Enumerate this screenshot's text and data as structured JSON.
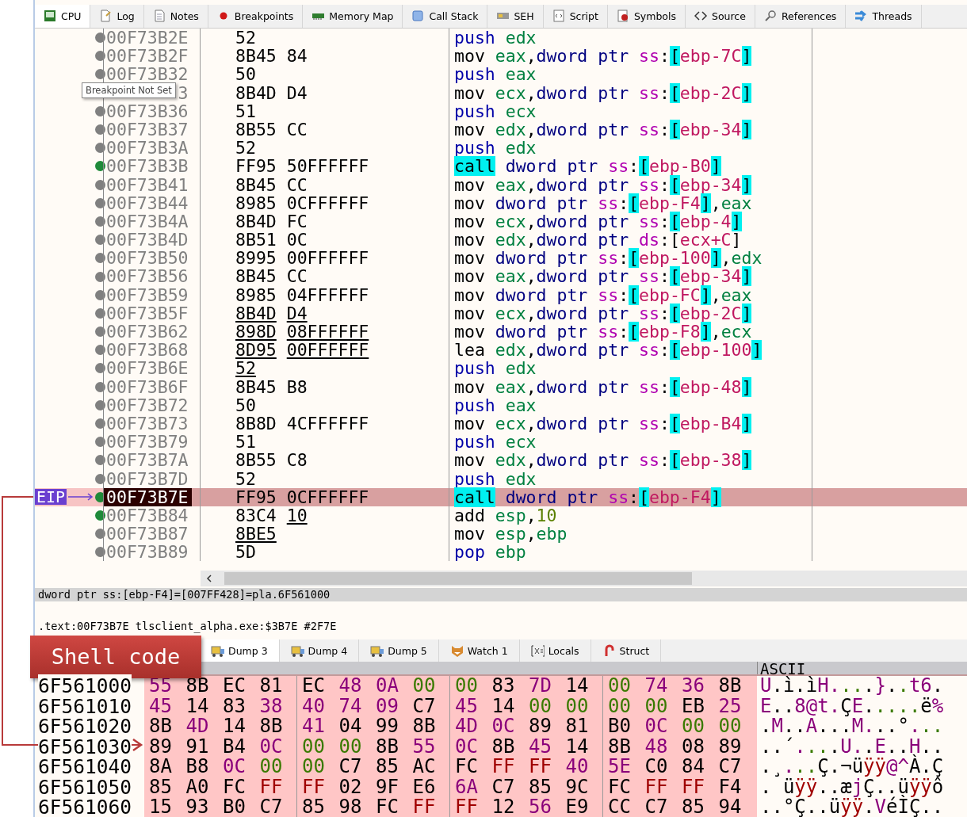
{
  "tabs": [
    {
      "label": "CPU",
      "selected": true
    },
    {
      "label": "Log",
      "selected": false
    },
    {
      "label": "Notes",
      "selected": false
    },
    {
      "label": "Breakpoints",
      "selected": false
    },
    {
      "label": "Memory Map",
      "selected": false
    },
    {
      "label": "Call Stack",
      "selected": false
    },
    {
      "label": "SEH",
      "selected": false
    },
    {
      "label": "Script",
      "selected": false
    },
    {
      "label": "Symbols",
      "selected": false
    },
    {
      "label": "Source",
      "selected": false
    },
    {
      "label": "References",
      "selected": false
    },
    {
      "label": "Threads",
      "selected": false
    }
  ],
  "eip_label": "EIP",
  "tooltip": {
    "text": "Breakpoint Not Set"
  },
  "disassembly": [
    {
      "address": "00F73B2E",
      "breakpoint": false,
      "selected": false,
      "eip": false,
      "bytes": [
        {
          "text": "52",
          "underlined": false
        }
      ],
      "mnemonic": {
        "text": "push",
        "kind": "stack"
      },
      "operands": [
        {
          "text": "edx",
          "kind": "reg"
        }
      ]
    },
    {
      "address": "00F73B2F",
      "breakpoint": false,
      "selected": false,
      "eip": false,
      "bytes": [
        {
          "text": "8B45 84",
          "underlined": false
        }
      ],
      "mnemonic": {
        "text": "mov",
        "kind": "move"
      },
      "operands": [
        {
          "text": "eax",
          "kind": "reg"
        },
        {
          "text": ",",
          "kind": "punct"
        },
        {
          "text": "dword ptr ",
          "kind": "size"
        },
        {
          "text": "ss",
          "kind": "seg"
        },
        {
          "text": ":",
          "kind": "punct"
        },
        {
          "text": "[",
          "kind": "bracket"
        },
        {
          "text": "ebp-7C",
          "kind": "mem"
        },
        {
          "text": "]",
          "kind": "bracket"
        }
      ]
    },
    {
      "address": "00F73B32",
      "breakpoint": false,
      "selected": false,
      "eip": false,
      "bytes": [
        {
          "text": "50",
          "underlined": false
        }
      ],
      "mnemonic": {
        "text": "push",
        "kind": "stack"
      },
      "operands": [
        {
          "text": "eax",
          "kind": "reg"
        }
      ]
    },
    {
      "address": "3",
      "selected": false,
      "eip": false,
      "bytes": [
        {
          "text": "8B4D D4",
          "underlined": false
        }
      ],
      "mnemonic": {
        "text": "mov",
        "kind": "move"
      },
      "operands": [
        {
          "text": "ecx",
          "kind": "reg"
        },
        {
          "text": ",",
          "kind": "punct"
        },
        {
          "text": "dword ptr ",
          "kind": "size"
        },
        {
          "text": "ss",
          "kind": "seg"
        },
        {
          "text": ":",
          "kind": "punct"
        },
        {
          "text": "[",
          "kind": "bracket"
        },
        {
          "text": "ebp-2C",
          "kind": "mem"
        },
        {
          "text": "]",
          "kind": "bracket"
        }
      ]
    },
    {
      "address": "00F73B36",
      "breakpoint": false,
      "selected": false,
      "eip": false,
      "bytes": [
        {
          "text": "51",
          "underlined": false
        }
      ],
      "mnemonic": {
        "text": "push",
        "kind": "stack"
      },
      "operands": [
        {
          "text": "ecx",
          "kind": "reg"
        }
      ]
    },
    {
      "address": "00F73B37",
      "breakpoint": false,
      "selected": false,
      "eip": false,
      "bytes": [
        {
          "text": "8B55 CC",
          "underlined": false
        }
      ],
      "mnemonic": {
        "text": "mov",
        "kind": "move"
      },
      "operands": [
        {
          "text": "edx",
          "kind": "reg"
        },
        {
          "text": ",",
          "kind": "punct"
        },
        {
          "text": "dword ptr ",
          "kind": "size"
        },
        {
          "text": "ss",
          "kind": "seg"
        },
        {
          "text": ":",
          "kind": "punct"
        },
        {
          "text": "[",
          "kind": "bracket"
        },
        {
          "text": "ebp-34",
          "kind": "mem"
        },
        {
          "text": "]",
          "kind": "bracket"
        }
      ]
    },
    {
      "address": "00F73B3A",
      "breakpoint": false,
      "selected": false,
      "eip": false,
      "bytes": [
        {
          "text": "52",
          "underlined": false
        }
      ],
      "mnemonic": {
        "text": "push",
        "kind": "stack"
      },
      "operands": [
        {
          "text": "edx",
          "kind": "reg"
        }
      ]
    },
    {
      "address": "00F73B3B",
      "breakpoint": true,
      "selected": false,
      "eip": false,
      "bytes": [
        {
          "text": "FF95 50FFFFFF",
          "underlined": false
        }
      ],
      "mnemonic": {
        "text": "call",
        "kind": "call"
      },
      "operands": [
        {
          "text": "dword ptr ",
          "kind": "size"
        },
        {
          "text": "ss",
          "kind": "seg"
        },
        {
          "text": ":",
          "kind": "punct"
        },
        {
          "text": "[",
          "kind": "bracket"
        },
        {
          "text": "ebp-B0",
          "kind": "mem"
        },
        {
          "text": "]",
          "kind": "bracket"
        }
      ]
    },
    {
      "address": "00F73B41",
      "breakpoint": false,
      "selected": false,
      "eip": false,
      "bytes": [
        {
          "text": "8B45 CC",
          "underlined": false
        }
      ],
      "mnemonic": {
        "text": "mov",
        "kind": "move"
      },
      "operands": [
        {
          "text": "eax",
          "kind": "reg"
        },
        {
          "text": ",",
          "kind": "punct"
        },
        {
          "text": "dword ptr ",
          "kind": "size"
        },
        {
          "text": "ss",
          "kind": "seg"
        },
        {
          "text": ":",
          "kind": "punct"
        },
        {
          "text": "[",
          "kind": "bracket"
        },
        {
          "text": "ebp-34",
          "kind": "mem"
        },
        {
          "text": "]",
          "kind": "bracket"
        }
      ]
    },
    {
      "address": "00F73B44",
      "breakpoint": false,
      "selected": false,
      "eip": false,
      "bytes": [
        {
          "text": "8985 0CFFFFFF",
          "underlined": false
        }
      ],
      "mnemonic": {
        "text": "mov",
        "kind": "move"
      },
      "operands": [
        {
          "text": "dword ptr ",
          "kind": "size"
        },
        {
          "text": "ss",
          "kind": "seg"
        },
        {
          "text": ":",
          "kind": "punct"
        },
        {
          "text": "[",
          "kind": "bracket"
        },
        {
          "text": "ebp-F4",
          "kind": "mem"
        },
        {
          "text": "]",
          "kind": "bracket"
        },
        {
          "text": ",",
          "kind": "punct"
        },
        {
          "text": "eax",
          "kind": "reg"
        }
      ]
    },
    {
      "address": "00F73B4A",
      "breakpoint": false,
      "selected": false,
      "eip": false,
      "bytes": [
        {
          "text": "8B4D FC",
          "underlined": false
        }
      ],
      "mnemonic": {
        "text": "mov",
        "kind": "move"
      },
      "operands": [
        {
          "text": "ecx",
          "kind": "reg"
        },
        {
          "text": ",",
          "kind": "punct"
        },
        {
          "text": "dword ptr ",
          "kind": "size"
        },
        {
          "text": "ss",
          "kind": "seg"
        },
        {
          "text": ":",
          "kind": "punct"
        },
        {
          "text": "[",
          "kind": "bracket"
        },
        {
          "text": "ebp-4",
          "kind": "mem"
        },
        {
          "text": "]",
          "kind": "bracket"
        }
      ]
    },
    {
      "address": "00F73B4D",
      "breakpoint": false,
      "selected": false,
      "eip": false,
      "bytes": [
        {
          "text": "8B51 0C",
          "underlined": false
        }
      ],
      "mnemonic": {
        "text": "mov",
        "kind": "move"
      },
      "operands": [
        {
          "text": "edx",
          "kind": "reg"
        },
        {
          "text": ",",
          "kind": "punct"
        },
        {
          "text": "dword ptr ",
          "kind": "size"
        },
        {
          "text": "ds",
          "kind": "seg"
        },
        {
          "text": ":",
          "kind": "punct"
        },
        {
          "text": "[",
          "kind": "punct"
        },
        {
          "text": "ecx+C",
          "kind": "mem"
        },
        {
          "text": "]",
          "kind": "punct"
        }
      ]
    },
    {
      "address": "00F73B50",
      "breakpoint": false,
      "selected": false,
      "eip": false,
      "bytes": [
        {
          "text": "8995 00FFFFFF",
          "underlined": false
        }
      ],
      "mnemonic": {
        "text": "mov",
        "kind": "move"
      },
      "operands": [
        {
          "text": "dword ptr ",
          "kind": "size"
        },
        {
          "text": "ss",
          "kind": "seg"
        },
        {
          "text": ":",
          "kind": "punct"
        },
        {
          "text": "[",
          "kind": "bracket"
        },
        {
          "text": "ebp-100",
          "kind": "mem"
        },
        {
          "text": "]",
          "kind": "bracket"
        },
        {
          "text": ",",
          "kind": "punct"
        },
        {
          "text": "edx",
          "kind": "reg"
        }
      ]
    },
    {
      "address": "00F73B56",
      "breakpoint": false,
      "selected": false,
      "eip": false,
      "bytes": [
        {
          "text": "8B45 CC",
          "underlined": false
        }
      ],
      "mnemonic": {
        "text": "mov",
        "kind": "move"
      },
      "operands": [
        {
          "text": "eax",
          "kind": "reg"
        },
        {
          "text": ",",
          "kind": "punct"
        },
        {
          "text": "dword ptr ",
          "kind": "size"
        },
        {
          "text": "ss",
          "kind": "seg"
        },
        {
          "text": ":",
          "kind": "punct"
        },
        {
          "text": "[",
          "kind": "bracket"
        },
        {
          "text": "ebp-34",
          "kind": "mem"
        },
        {
          "text": "]",
          "kind": "bracket"
        }
      ]
    },
    {
      "address": "00F73B59",
      "breakpoint": false,
      "selected": false,
      "eip": false,
      "bytes": [
        {
          "text": "8985 04FFFFFF",
          "underlined": false
        }
      ],
      "mnemonic": {
        "text": "mov",
        "kind": "move"
      },
      "operands": [
        {
          "text": "dword ptr ",
          "kind": "size"
        },
        {
          "text": "ss",
          "kind": "seg"
        },
        {
          "text": ":",
          "kind": "punct"
        },
        {
          "text": "[",
          "kind": "bracket"
        },
        {
          "text": "ebp-FC",
          "kind": "mem"
        },
        {
          "text": "]",
          "kind": "bracket"
        },
        {
          "text": ",",
          "kind": "punct"
        },
        {
          "text": "eax",
          "kind": "reg"
        }
      ]
    },
    {
      "address": "00F73B5F",
      "breakpoint": false,
      "selected": false,
      "eip": false,
      "bytes": [
        {
          "text": "8B4D",
          "underlined": true
        },
        {
          "text": "D4",
          "underlined": true
        }
      ],
      "mnemonic": {
        "text": "mov",
        "kind": "move"
      },
      "operands": [
        {
          "text": "ecx",
          "kind": "reg"
        },
        {
          "text": ",",
          "kind": "punct"
        },
        {
          "text": "dword ptr ",
          "kind": "size"
        },
        {
          "text": "ss",
          "kind": "seg"
        },
        {
          "text": ":",
          "kind": "punct"
        },
        {
          "text": "[",
          "kind": "bracket"
        },
        {
          "text": "ebp-2C",
          "kind": "mem"
        },
        {
          "text": "]",
          "kind": "bracket"
        }
      ]
    },
    {
      "address": "00F73B62",
      "breakpoint": false,
      "selected": false,
      "eip": false,
      "bytes": [
        {
          "text": "898D",
          "underlined": true
        },
        {
          "text": "08FFFFFF",
          "underlined": true
        }
      ],
      "mnemonic": {
        "text": "mov",
        "kind": "move"
      },
      "operands": [
        {
          "text": "dword ptr ",
          "kind": "size"
        },
        {
          "text": "ss",
          "kind": "seg"
        },
        {
          "text": ":",
          "kind": "punct"
        },
        {
          "text": "[",
          "kind": "bracket"
        },
        {
          "text": "ebp-F8",
          "kind": "mem"
        },
        {
          "text": "]",
          "kind": "bracket"
        },
        {
          "text": ",",
          "kind": "punct"
        },
        {
          "text": "ecx",
          "kind": "reg"
        }
      ]
    },
    {
      "address": "00F73B68",
      "breakpoint": false,
      "selected": false,
      "eip": false,
      "bytes": [
        {
          "text": "8D95",
          "underlined": true
        },
        {
          "text": "00FFFFFF",
          "underlined": true
        }
      ],
      "mnemonic": {
        "text": "lea",
        "kind": "move"
      },
      "operands": [
        {
          "text": "edx",
          "kind": "reg"
        },
        {
          "text": ",",
          "kind": "punct"
        },
        {
          "text": "dword ptr ",
          "kind": "size"
        },
        {
          "text": "ss",
          "kind": "seg"
        },
        {
          "text": ":",
          "kind": "punct"
        },
        {
          "text": "[",
          "kind": "bracket"
        },
        {
          "text": "ebp-100",
          "kind": "mem"
        },
        {
          "text": "]",
          "kind": "bracket"
        }
      ]
    },
    {
      "address": "00F73B6E",
      "breakpoint": false,
      "selected": false,
      "eip": false,
      "bytes": [
        {
          "text": "52",
          "underlined": true
        }
      ],
      "mnemonic": {
        "text": "push",
        "kind": "stack"
      },
      "operands": [
        {
          "text": "edx",
          "kind": "reg"
        }
      ]
    },
    {
      "address": "00F73B6F",
      "breakpoint": false,
      "selected": false,
      "eip": false,
      "bytes": [
        {
          "text": "8B45 B8",
          "underlined": false
        }
      ],
      "mnemonic": {
        "text": "mov",
        "kind": "move"
      },
      "operands": [
        {
          "text": "eax",
          "kind": "reg"
        },
        {
          "text": ",",
          "kind": "punct"
        },
        {
          "text": "dword ptr ",
          "kind": "size"
        },
        {
          "text": "ss",
          "kind": "seg"
        },
        {
          "text": ":",
          "kind": "punct"
        },
        {
          "text": "[",
          "kind": "bracket"
        },
        {
          "text": "ebp-48",
          "kind": "mem"
        },
        {
          "text": "]",
          "kind": "bracket"
        }
      ]
    },
    {
      "address": "00F73B72",
      "breakpoint": false,
      "selected": false,
      "eip": false,
      "bytes": [
        {
          "text": "50",
          "underlined": false
        }
      ],
      "mnemonic": {
        "text": "push",
        "kind": "stack"
      },
      "operands": [
        {
          "text": "eax",
          "kind": "reg"
        }
      ]
    },
    {
      "address": "00F73B73",
      "breakpoint": false,
      "selected": false,
      "eip": false,
      "bytes": [
        {
          "text": "8B8D 4CFFFFFF",
          "underlined": false
        }
      ],
      "mnemonic": {
        "text": "mov",
        "kind": "move"
      },
      "operands": [
        {
          "text": "ecx",
          "kind": "reg"
        },
        {
          "text": ",",
          "kind": "punct"
        },
        {
          "text": "dword ptr ",
          "kind": "size"
        },
        {
          "text": "ss",
          "kind": "seg"
        },
        {
          "text": ":",
          "kind": "punct"
        },
        {
          "text": "[",
          "kind": "bracket"
        },
        {
          "text": "ebp-B4",
          "kind": "mem"
        },
        {
          "text": "]",
          "kind": "bracket"
        }
      ]
    },
    {
      "address": "00F73B79",
      "breakpoint": false,
      "selected": false,
      "eip": false,
      "bytes": [
        {
          "text": "51",
          "underlined": false
        }
      ],
      "mnemonic": {
        "text": "push",
        "kind": "stack"
      },
      "operands": [
        {
          "text": "ecx",
          "kind": "reg"
        }
      ]
    },
    {
      "address": "00F73B7A",
      "breakpoint": false,
      "selected": false,
      "eip": false,
      "bytes": [
        {
          "text": "8B55 C8",
          "underlined": false
        }
      ],
      "mnemonic": {
        "text": "mov",
        "kind": "move"
      },
      "operands": [
        {
          "text": "edx",
          "kind": "reg"
        },
        {
          "text": ",",
          "kind": "punct"
        },
        {
          "text": "dword ptr ",
          "kind": "size"
        },
        {
          "text": "ss",
          "kind": "seg"
        },
        {
          "text": ":",
          "kind": "punct"
        },
        {
          "text": "[",
          "kind": "bracket"
        },
        {
          "text": "ebp-38",
          "kind": "mem"
        },
        {
          "text": "]",
          "kind": "bracket"
        }
      ]
    },
    {
      "address": "00F73B7D",
      "breakpoint": false,
      "selected": false,
      "eip": false,
      "bytes": [
        {
          "text": "52",
          "underlined": false
        }
      ],
      "mnemonic": {
        "text": "push",
        "kind": "stack"
      },
      "operands": [
        {
          "text": "edx",
          "kind": "reg"
        }
      ]
    },
    {
      "address": "00F73B7E",
      "breakpoint": true,
      "selected": true,
      "eip": true,
      "bytes": [
        {
          "text": "FF95 0CFFFFFF",
          "underlined": false
        }
      ],
      "mnemonic": {
        "text": "call",
        "kind": "call"
      },
      "operands": [
        {
          "text": "dword ptr ",
          "kind": "size"
        },
        {
          "text": "ss",
          "kind": "seg"
        },
        {
          "text": ":",
          "kind": "punct"
        },
        {
          "text": "[",
          "kind": "bracket"
        },
        {
          "text": "ebp-F4",
          "kind": "mem"
        },
        {
          "text": "]",
          "kind": "bracket"
        }
      ]
    },
    {
      "address": "00F73B84",
      "breakpoint": true,
      "selected": false,
      "eip": false,
      "bytes": [
        {
          "text": "83C4",
          "underlined": false
        },
        {
          "text": "10",
          "underlined": true
        }
      ],
      "mnemonic": {
        "text": "add",
        "kind": "move"
      },
      "operands": [
        {
          "text": "esp",
          "kind": "reg"
        },
        {
          "text": ",",
          "kind": "punct"
        },
        {
          "text": "10",
          "kind": "num"
        }
      ]
    },
    {
      "address": "00F73B87",
      "breakpoint": false,
      "selected": false,
      "eip": false,
      "bytes": [
        {
          "text": "8BE5",
          "underlined": true
        }
      ],
      "mnemonic": {
        "text": "mov",
        "kind": "move"
      },
      "operands": [
        {
          "text": "esp",
          "kind": "reg"
        },
        {
          "text": ",",
          "kind": "punct"
        },
        {
          "text": "ebp",
          "kind": "reg"
        }
      ]
    },
    {
      "address": "00F73B89",
      "breakpoint": false,
      "selected": false,
      "eip": false,
      "bytes": [
        {
          "text": "5D",
          "underlined": false
        }
      ],
      "mnemonic": {
        "text": "pop",
        "kind": "stack"
      },
      "operands": [
        {
          "text": "ebp",
          "kind": "reg"
        }
      ]
    }
  ],
  "info": {
    "line_1": "dword ptr ss:[ebp-F4]=[007FF428]=pla.6F561000",
    "line_2": ".text:00F73B7E tlsclient_alpha.exe:$3B7E #2F7E"
  },
  "callout": {
    "text": "Shell code"
  },
  "bottom_tabs": [
    {
      "label": "Dump 3",
      "selected": true
    },
    {
      "label": "Dump 4",
      "selected": false
    },
    {
      "label": "Dump 5",
      "selected": false
    },
    {
      "label": "Watch 1",
      "selected": false
    },
    {
      "label": "Locals",
      "selected": false
    },
    {
      "label": "Struct",
      "selected": false
    }
  ],
  "dump": {
    "ascii_header": "ASCII",
    "rows": [
      {
        "address": "6F561000",
        "ascii": "U.ì.ìH....}..t6.",
        "bytes": [
          {
            "text": "55",
            "kind": "print"
          },
          {
            "text": "8B",
            "kind": "other"
          },
          {
            "text": "EC",
            "kind": "other"
          },
          {
            "text": "81",
            "kind": "other"
          },
          {
            "text": "EC",
            "kind": "other"
          },
          {
            "text": "48",
            "kind": "print"
          },
          {
            "text": "0A",
            "kind": "print"
          },
          {
            "text": "00",
            "kind": "zero"
          },
          {
            "text": "00",
            "kind": "zero"
          },
          {
            "text": "83",
            "kind": "other"
          },
          {
            "text": "7D",
            "kind": "print"
          },
          {
            "text": "14",
            "kind": "other"
          },
          {
            "text": "00",
            "kind": "zero"
          },
          {
            "text": "74",
            "kind": "print"
          },
          {
            "text": "36",
            "kind": "print"
          },
          {
            "text": "8B",
            "kind": "other"
          }
        ]
      },
      {
        "address": "6F561010",
        "ascii": "E..8@t.ÇE.....ë%",
        "bytes": [
          {
            "text": "45",
            "kind": "print"
          },
          {
            "text": "14",
            "kind": "other"
          },
          {
            "text": "83",
            "kind": "other"
          },
          {
            "text": "38",
            "kind": "print"
          },
          {
            "text": "40",
            "kind": "print"
          },
          {
            "text": "74",
            "kind": "print"
          },
          {
            "text": "09",
            "kind": "print"
          },
          {
            "text": "C7",
            "kind": "other"
          },
          {
            "text": "45",
            "kind": "print"
          },
          {
            "text": "14",
            "kind": "other"
          },
          {
            "text": "00",
            "kind": "zero"
          },
          {
            "text": "00",
            "kind": "zero"
          },
          {
            "text": "00",
            "kind": "zero"
          },
          {
            "text": "00",
            "kind": "zero"
          },
          {
            "text": "EB",
            "kind": "other"
          },
          {
            "text": "25",
            "kind": "print"
          }
        ]
      },
      {
        "address": "6F561020",
        "ascii": ".M..A...M...°...",
        "bytes": [
          {
            "text": "8B",
            "kind": "other"
          },
          {
            "text": "4D",
            "kind": "print"
          },
          {
            "text": "14",
            "kind": "other"
          },
          {
            "text": "8B",
            "kind": "other"
          },
          {
            "text": "41",
            "kind": "print"
          },
          {
            "text": "04",
            "kind": "other"
          },
          {
            "text": "99",
            "kind": "other"
          },
          {
            "text": "8B",
            "kind": "other"
          },
          {
            "text": "4D",
            "kind": "print"
          },
          {
            "text": "0C",
            "kind": "print"
          },
          {
            "text": "89",
            "kind": "other"
          },
          {
            "text": "81",
            "kind": "other"
          },
          {
            "text": "B0",
            "kind": "other"
          },
          {
            "text": "0C",
            "kind": "print"
          },
          {
            "text": "00",
            "kind": "zero"
          },
          {
            "text": "00",
            "kind": "zero"
          }
        ]
      },
      {
        "address": "6F561030",
        "ascii": "..´....U..E..H..",
        "bytes": [
          {
            "text": "89",
            "kind": "other"
          },
          {
            "text": "91",
            "kind": "other"
          },
          {
            "text": "B4",
            "kind": "other"
          },
          {
            "text": "0C",
            "kind": "print"
          },
          {
            "text": "00",
            "kind": "zero"
          },
          {
            "text": "00",
            "kind": "zero"
          },
          {
            "text": "8B",
            "kind": "other"
          },
          {
            "text": "55",
            "kind": "print"
          },
          {
            "text": "0C",
            "kind": "print"
          },
          {
            "text": "8B",
            "kind": "other"
          },
          {
            "text": "45",
            "kind": "print"
          },
          {
            "text": "14",
            "kind": "other"
          },
          {
            "text": "8B",
            "kind": "other"
          },
          {
            "text": "48",
            "kind": "print"
          },
          {
            "text": "08",
            "kind": "other"
          },
          {
            "text": "89",
            "kind": "other"
          }
        ]
      },
      {
        "address": "6F561040",
        "ascii": ".¸...Ç.¬üÿÿ@^À.Ç",
        "bytes": [
          {
            "text": "8A",
            "kind": "other"
          },
          {
            "text": "B8",
            "kind": "other"
          },
          {
            "text": "0C",
            "kind": "print"
          },
          {
            "text": "00",
            "kind": "zero"
          },
          {
            "text": "00",
            "kind": "zero"
          },
          {
            "text": "C7",
            "kind": "other"
          },
          {
            "text": "85",
            "kind": "other"
          },
          {
            "text": "AC",
            "kind": "other"
          },
          {
            "text": "FC",
            "kind": "other"
          },
          {
            "text": "FF",
            "kind": "ff"
          },
          {
            "text": "FF",
            "kind": "ff"
          },
          {
            "text": "40",
            "kind": "print"
          },
          {
            "text": "5E",
            "kind": "print"
          },
          {
            "text": "C0",
            "kind": "other"
          },
          {
            "text": "84",
            "kind": "other"
          },
          {
            "text": "C7",
            "kind": "other"
          }
        ]
      },
      {
        "address": "6F561050",
        "ascii": ". üÿÿ..æjÇ..üÿÿô",
        "bytes": [
          {
            "text": "85",
            "kind": "other"
          },
          {
            "text": "A0",
            "kind": "other"
          },
          {
            "text": "FC",
            "kind": "other"
          },
          {
            "text": "FF",
            "kind": "ff"
          },
          {
            "text": "FF",
            "kind": "ff"
          },
          {
            "text": "02",
            "kind": "other"
          },
          {
            "text": "9F",
            "kind": "other"
          },
          {
            "text": "E6",
            "kind": "other"
          },
          {
            "text": "6A",
            "kind": "print"
          },
          {
            "text": "C7",
            "kind": "other"
          },
          {
            "text": "85",
            "kind": "other"
          },
          {
            "text": "9C",
            "kind": "other"
          },
          {
            "text": "FC",
            "kind": "other"
          },
          {
            "text": "FF",
            "kind": "ff"
          },
          {
            "text": "FF",
            "kind": "ff"
          },
          {
            "text": "F4",
            "kind": "other"
          }
        ]
      },
      {
        "address": "6F561060",
        "ascii": "..°Ç..üÿÿ.VéÌÇ..",
        "bytes": [
          {
            "text": "15",
            "kind": "other"
          },
          {
            "text": "93",
            "kind": "other"
          },
          {
            "text": "B0",
            "kind": "other"
          },
          {
            "text": "C7",
            "kind": "other"
          },
          {
            "text": "85",
            "kind": "other"
          },
          {
            "text": "98",
            "kind": "other"
          },
          {
            "text": "FC",
            "kind": "other"
          },
          {
            "text": "FF",
            "kind": "ff"
          },
          {
            "text": "FF",
            "kind": "ff"
          },
          {
            "text": "12",
            "kind": "other"
          },
          {
            "text": "56",
            "kind": "print"
          },
          {
            "text": "E9",
            "kind": "other"
          },
          {
            "text": "CC",
            "kind": "other"
          },
          {
            "text": "C7",
            "kind": "other"
          },
          {
            "text": "85",
            "kind": "other"
          },
          {
            "text": "94",
            "kind": "other"
          }
        ]
      }
    ]
  }
}
